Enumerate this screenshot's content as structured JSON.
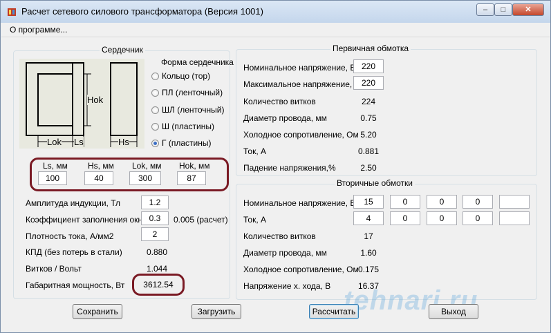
{
  "window": {
    "title": "Расчет сетевого силового трансформатора (Версия 1001)",
    "controls": {
      "minimize": "–",
      "maximize": "□",
      "close": "✕"
    }
  },
  "menu": {
    "about": "О программе..."
  },
  "core": {
    "group_title": "Сердечник",
    "shape_title": "Форма сердечника",
    "shapes": [
      {
        "label": "Кольцо  (тор)",
        "selected": false
      },
      {
        "label": "ПЛ  (ленточный)",
        "selected": false
      },
      {
        "label": "ШЛ  (ленточный)",
        "selected": false
      },
      {
        "label": "Ш  (пластины)",
        "selected": false
      },
      {
        "label": "Г (пластины)",
        "selected": true
      }
    ],
    "diagram_labels": {
      "hok": "Hok",
      "lok": "Lok",
      "ls": "Ls",
      "hs": "Hs"
    },
    "dims": {
      "ls_label": "Ls, мм",
      "ls_value": "100",
      "hs_label": "Hs, мм",
      "hs_value": "40",
      "lok_label": "Lok, мм",
      "lok_value": "300",
      "hok_label": "Hok, мм",
      "hok_value": "87"
    }
  },
  "params": {
    "induction_label": "Амплитуда индукции, Тл",
    "induction_value": "1.2",
    "fill_label": "Коэффициент заполнения окна",
    "fill_value": "0.3",
    "fill_calc": "0.005 (расчет)",
    "current_density_label": "Плотность тока, А/мм2",
    "current_density_value": "2",
    "efficiency_label": "КПД (без потерь в стали)",
    "efficiency_value": "0.880",
    "turns_per_volt_label": "Витков / Вольт",
    "turns_per_volt_value": "1.044",
    "power_label": "Габаритная мощность, Вт",
    "power_value": "3612.54"
  },
  "primary": {
    "group_title": "Первичная обмотка",
    "nominal_voltage_label": "Номинальное напряжение, В",
    "nominal_voltage_value": "220",
    "max_voltage_label": "Максимальное напряжение, В",
    "max_voltage_value": "220",
    "turns_label": "Количество витков",
    "turns_value": "224",
    "wire_label": "Диаметр провода, мм",
    "wire_value": "0.75",
    "resistance_label": "Холодное сопротивление, Ом",
    "resistance_value": "5.20",
    "current_label": "Ток, А",
    "current_value": "0.881",
    "drop_label": "Падение напряжения,%",
    "drop_value": "2.50"
  },
  "secondary": {
    "group_title": "Вторичные обмотки",
    "nominal_voltage_label": "Номинальное напряжение, В",
    "voltages": [
      "15",
      "0",
      "0",
      "0",
      ""
    ],
    "current_label": "Ток, А",
    "currents": [
      "4",
      "0",
      "0",
      "0",
      ""
    ],
    "turns_label": "Количество витков",
    "turns_value": "17",
    "wire_label": "Диаметр провода, мм",
    "wire_value": "1.60",
    "resistance_label": "Холодное сопротивление, Ом",
    "resistance_value": "0.175",
    "open_voltage_label": "Напряжение х. хода, В",
    "open_voltage_value": "16.37"
  },
  "buttons": {
    "save": "Сохранить",
    "load": "Загрузить",
    "calc": "Рассчитать",
    "exit": "Выход"
  },
  "watermark": "tehnari.ru",
  "colors": {
    "highlight_frame": "#7a1a24",
    "selected_radio": "#3b6ec4"
  }
}
